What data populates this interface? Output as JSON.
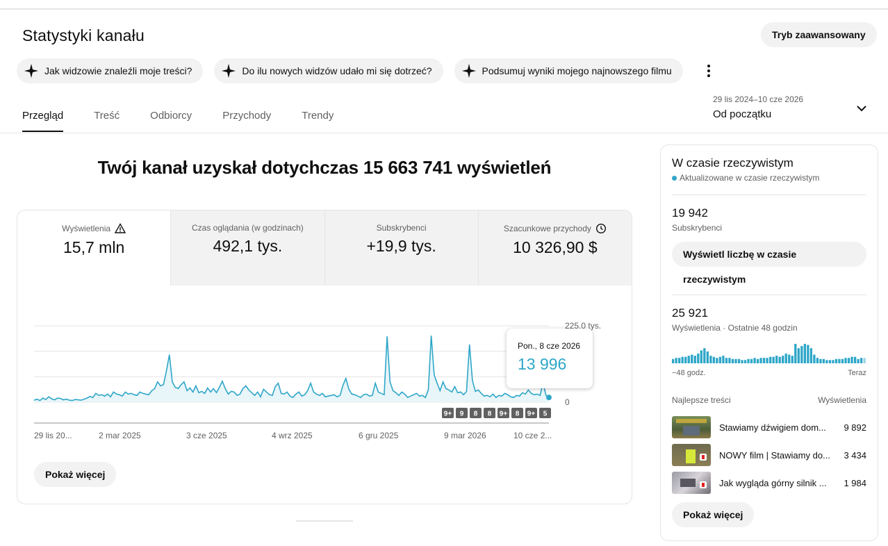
{
  "page": {
    "title": "Statystyki kanału",
    "advanced_label": "Tryb zaawansowany"
  },
  "chips": [
    "Jak widzowie znaleźli moje treści?",
    "Do ilu nowych widzów udało mi się dotrzeć?",
    "Podsumuj wyniki mojego najnowszego filmu"
  ],
  "tabs": [
    "Przegląd",
    "Treść",
    "Odbiorcy",
    "Przychody",
    "Trendy"
  ],
  "range": {
    "dates": "29 lis 2024–10 cze 2026",
    "period": "Od początku"
  },
  "headline": "Twój kanał uzyskał dotychczas 15 663 741 wyświetleń",
  "metrics": [
    {
      "label": "Wyświetlenia",
      "value": "15,7 mln"
    },
    {
      "label": "Czas oglądania (w godzinach)",
      "value": "492,1 tys."
    },
    {
      "label": "Subskrybenci",
      "value": "+19,9 tys."
    },
    {
      "label": "Szacunkowe przychody",
      "value": "10 326,90 $"
    }
  ],
  "chart_data": {
    "type": "area",
    "x_tick_labels": [
      "29 lis 20...",
      "2 mar 2025",
      "3 cze 2025",
      "4 wrz 2025",
      "6 gru 2025",
      "9 mar 2026",
      "10 cze 2..."
    ],
    "y_tick_labels": [
      "225,0 tys.",
      "0"
    ],
    "ylim": [
      0,
      225000
    ],
    "color": "#2ea6c8",
    "values": [
      6000,
      9000,
      5000,
      12000,
      8000,
      16000,
      10000,
      7000,
      12000,
      11000,
      7000,
      9000,
      6000,
      5000,
      8000,
      7000,
      6000,
      9000,
      12000,
      17000,
      14000,
      26000,
      20000,
      22000,
      18000,
      24000,
      16000,
      30000,
      24000,
      22000,
      18000,
      30000,
      24000,
      26000,
      22000,
      20000,
      30000,
      26000,
      24000,
      22000,
      34000,
      40000,
      60000,
      48000,
      52000,
      92000,
      140000,
      60000,
      44000,
      40000,
      52000,
      60000,
      34000,
      42000,
      30000,
      48000,
      28000,
      32000,
      26000,
      42000,
      30000,
      40000,
      28000,
      44000,
      62000,
      40000,
      24000,
      32000,
      30000,
      20000,
      24000,
      40000,
      48000,
      36000,
      28000,
      20000,
      30000,
      16000,
      38000,
      30000,
      22000,
      20000,
      46000,
      56000,
      26000,
      24000,
      30000,
      18000,
      14000,
      24000,
      30000,
      18000,
      22000,
      34000,
      56000,
      30000,
      24000,
      20000,
      26000,
      16000,
      18000,
      20000,
      22000,
      16000,
      20000,
      50000,
      70000,
      38000,
      24000,
      22000,
      18000,
      14000,
      22000,
      24000,
      18000,
      20000,
      56000,
      30000,
      26000,
      22000,
      194000,
      60000,
      34000,
      28000,
      20000,
      30000,
      24000,
      14000,
      18000,
      22000,
      26000,
      18000,
      20000,
      14000,
      36000,
      196000,
      80000,
      56000,
      34000,
      60000,
      40000,
      36000,
      30000,
      46000,
      28000,
      30000,
      22000,
      32000,
      170000,
      64000,
      32000,
      36000,
      26000,
      18000,
      20000,
      16000,
      24000,
      14000,
      20000,
      18000,
      26000,
      22000,
      16000,
      14000,
      20000,
      18000,
      28000,
      24000,
      36000,
      26000,
      22000,
      24000,
      20000,
      58000,
      20000,
      14000
    ]
  },
  "tooltip": {
    "date": "Pon., 8 cze 2026",
    "value": "13 996"
  },
  "badges": [
    "9+",
    "9",
    "8",
    "8",
    "9+",
    "8",
    "9+",
    "5"
  ],
  "more_label": "Pokaż więcej",
  "realtime": {
    "title": "W czasie rzeczywistym",
    "subtitle": "Aktualizowane w czasie rzeczywistym",
    "subs_value": "19 942",
    "subs_label": "Subskrybenci",
    "live_btn": "Wyświetl liczbę w czasie rzeczywistym",
    "views_value": "25 921",
    "views_label": "Wyświetlenia · Ostatnie 48 godzin",
    "bars": [
      4,
      5,
      5,
      6,
      6,
      7,
      8,
      7,
      9,
      12,
      14,
      11,
      7,
      6,
      5,
      6,
      7,
      5,
      5,
      4,
      4,
      4,
      3,
      3,
      4,
      4,
      5,
      4,
      5,
      5,
      5,
      6,
      6,
      7,
      6,
      7,
      9,
      8,
      7,
      18,
      14,
      16,
      18,
      17,
      14,
      8,
      5,
      4,
      4,
      3,
      3,
      3,
      4,
      4,
      4,
      5,
      5,
      6,
      6,
      4,
      5,
      5
    ],
    "axis_left": "−48 godz.",
    "axis_right": "Teraz",
    "top_label": "Najlepsze treści",
    "top_views_label": "Wyświetlenia",
    "top": [
      {
        "title": "Stawiamy dźwigiem dom...",
        "views": "9 892"
      },
      {
        "title": "NOWY film | Stawiamy do...",
        "views": "3 434"
      },
      {
        "title": "Jak wygląda górny silnik ...",
        "views": "1 984"
      }
    ],
    "more_label": "Pokaż więcej"
  }
}
